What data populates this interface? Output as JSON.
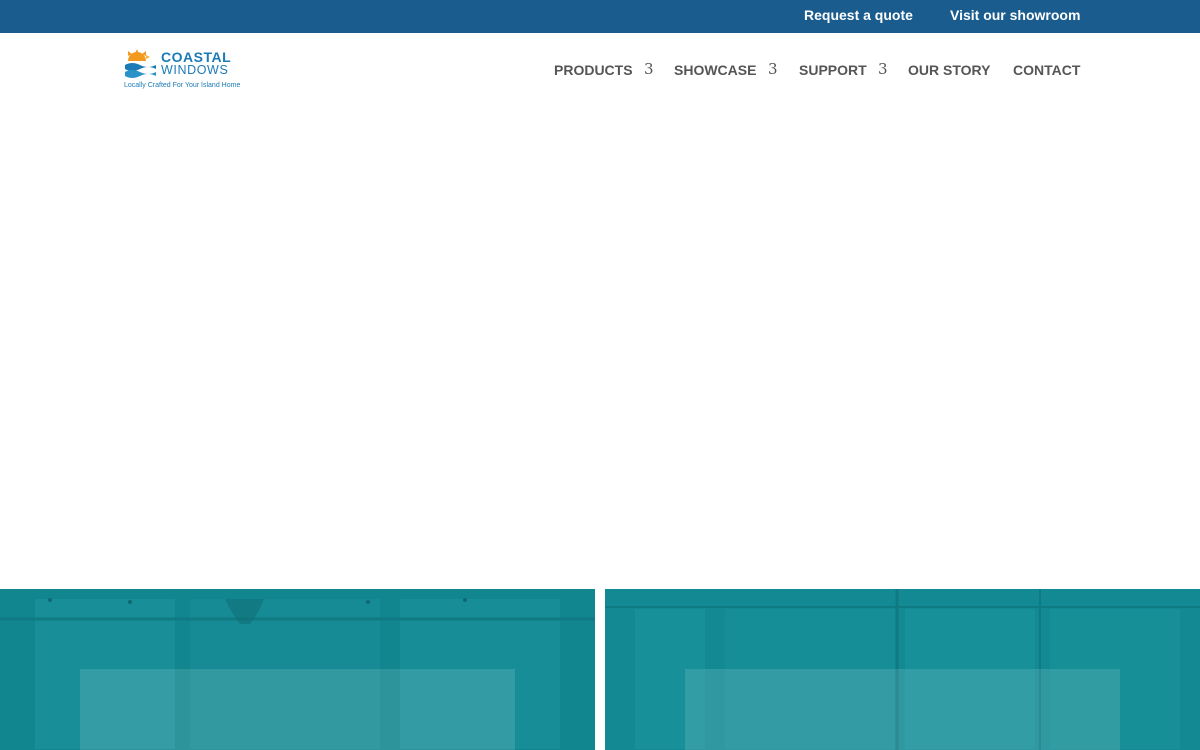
{
  "topbar": {
    "request_quote": "Request a quote",
    "visit_showroom": "Visit our showroom"
  },
  "logo": {
    "line1": "COASTAL",
    "line2": "WINDOWS",
    "tagline": "Locally Crafted For Your Island Home"
  },
  "nav": {
    "items": [
      {
        "label": "PRODUCTS",
        "has_dropdown": true
      },
      {
        "label": "SHOWCASE",
        "has_dropdown": true
      },
      {
        "label": "SUPPORT",
        "has_dropdown": true
      },
      {
        "label": "OUR STORY",
        "has_dropdown": false
      },
      {
        "label": "CONTACT",
        "has_dropdown": false
      }
    ],
    "dropdown_glyph": "3"
  },
  "colors": {
    "topbar": "#1a5c8e",
    "brand_blue": "#1c7ab6",
    "nav_text": "#555555",
    "tile_teal": "#138a93"
  },
  "icons": {
    "logo": "sun-waves-logo-icon",
    "dropdown": "chevron-down-icon"
  }
}
